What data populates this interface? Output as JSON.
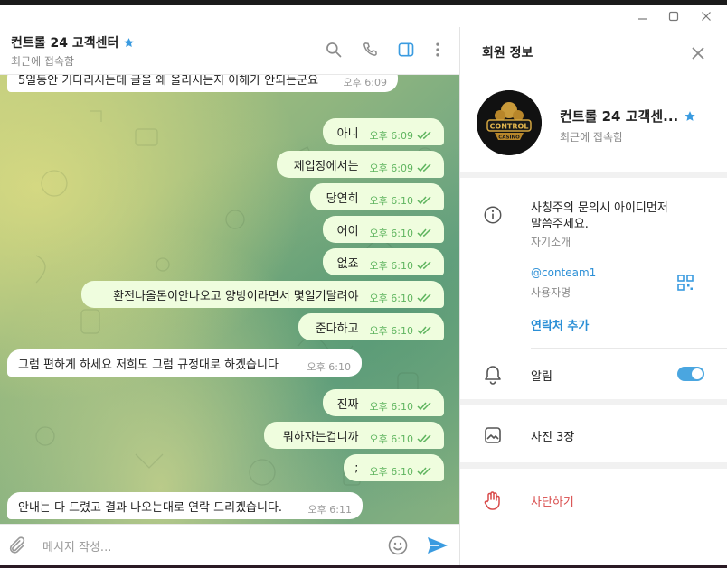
{
  "window": {
    "controls": {
      "minimize": "—",
      "maximize": "☐",
      "close": "✕"
    }
  },
  "chat": {
    "title": "컨트롤 24 고객센터",
    "status": "최근에 접속함",
    "input_placeholder": "메시지 작성...",
    "messages": [
      {
        "dir": "in",
        "text": "5일동안 기다리시는데 글을 왜 올리시는지 이해가 안되는군요",
        "time": "오후 6:09"
      },
      {
        "dir": "out",
        "text": "아니",
        "time": "오후 6:09"
      },
      {
        "dir": "out",
        "text": "제입장에서는",
        "time": "오후 6:09"
      },
      {
        "dir": "out",
        "text": "당연히",
        "time": "오후 6:10"
      },
      {
        "dir": "out",
        "text": "어이",
        "time": "오후 6:10"
      },
      {
        "dir": "out",
        "text": "없죠",
        "time": "오후 6:10"
      },
      {
        "dir": "out",
        "text": "환전나올돈이안나오고 양방이라면서 몇일기달려야",
        "time": "오후 6:10"
      },
      {
        "dir": "out",
        "text": "준다하고",
        "time": "오후 6:10"
      },
      {
        "dir": "in",
        "text": "그럼 편하게 하세요 저희도 그럼 규정대로 하겠습니다",
        "time": "오후 6:10"
      },
      {
        "dir": "out",
        "text": "진짜",
        "time": "오후 6:10"
      },
      {
        "dir": "out",
        "text": "뭐하자는겁니까",
        "time": "오후 6:10"
      },
      {
        "dir": "out",
        "text": ";",
        "time": "오후 6:10"
      },
      {
        "dir": "in",
        "text": "안내는 다 드렸고 결과 나오는대로 연락 드리겠습니다.",
        "time": "오후 6:11"
      }
    ]
  },
  "panel": {
    "title": "회원 정보",
    "profile_name": "컨트롤 24 고객센...",
    "profile_status": "최근에 접속함",
    "avatar_text": {
      "line1": "CONTROL",
      "line2": "CASINO"
    },
    "bio_line1": "사칭주의 문의시 아이디먼저",
    "bio_line2": "말씀주세요.",
    "bio_label": "자기소개",
    "username": "@conteam1",
    "username_label": "사용자명",
    "add_contact": "연락처 추가",
    "notifications": "알림",
    "notifications_on": true,
    "photos": "사진 3장",
    "block": "차단하기"
  },
  "colors": {
    "accent": "#2b8fd6",
    "outgoing_bubble": "#effdde",
    "check": "#5eb45e",
    "danger": "#d84a4a"
  }
}
